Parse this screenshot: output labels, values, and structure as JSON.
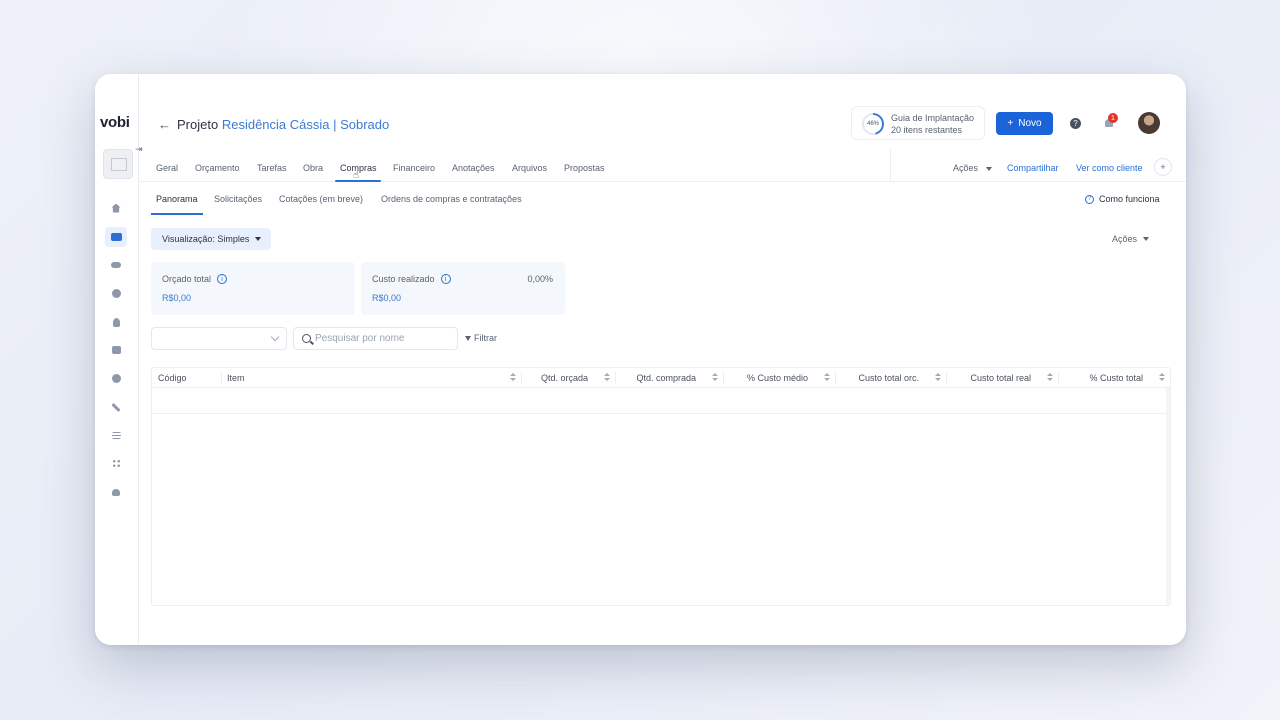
{
  "app": {
    "logo": "vobi"
  },
  "header": {
    "back_glyph": "←",
    "title_prefix": "Projeto",
    "project_name": "Residência Cássia | Sobrado",
    "guide": {
      "percent": "46%",
      "line1": "Guia de Implantação",
      "line2": "20 itens restantes"
    },
    "new_button": "Novo",
    "new_button_icon": "+",
    "help_glyph": "?",
    "notification_count": "1"
  },
  "tabs": [
    {
      "label": "Geral"
    },
    {
      "label": "Orçamento"
    },
    {
      "label": "Tarefas"
    },
    {
      "label": "Obra"
    },
    {
      "label": "Compras",
      "active": true
    },
    {
      "label": "Financeiro"
    },
    {
      "label": "Anotações"
    },
    {
      "label": "Arquivos"
    },
    {
      "label": "Propostas"
    }
  ],
  "tab_actions": {
    "acoes": "Ações",
    "compartilhar": "Compartilhar",
    "ver_cliente": "Ver como cliente",
    "plus": "+"
  },
  "subtabs": [
    {
      "label": "Panorama",
      "active": true
    },
    {
      "label": "Solicitações"
    },
    {
      "label": "Cotações (em breve)"
    },
    {
      "label": "Ordens de compras e contratações"
    }
  ],
  "how_it_works": "Como funciona",
  "toolbar": {
    "visualization": "Visualização: Simples",
    "acoes": "Ações",
    "search_placeholder": "Pesquisar por nome",
    "filter": "Filtrar"
  },
  "cards": {
    "orcado": {
      "label": "Orçado total",
      "value": "R$0,00"
    },
    "realizado": {
      "label": "Custo realizado",
      "value": "R$0,00",
      "percent": "0,00%"
    }
  },
  "table": {
    "headers": [
      "Código",
      "Item",
      "Qtd. orçada",
      "Qtd. comprada",
      "% Custo médio",
      "Custo total orc.",
      "Custo total real",
      "% Custo total"
    ]
  },
  "sidebar_icons": [
    "home-icon",
    "folder-icon",
    "handshake-icon",
    "dollar-icon",
    "worker-icon",
    "stack-icon",
    "coin-icon",
    "tools-icon",
    "list-icon",
    "apps-icon",
    "users-icon"
  ],
  "colors": {
    "accent": "#1b63d8",
    "link": "#3a7bd5",
    "badge": "#e0352b",
    "active_bg": "#e8f0fd"
  }
}
